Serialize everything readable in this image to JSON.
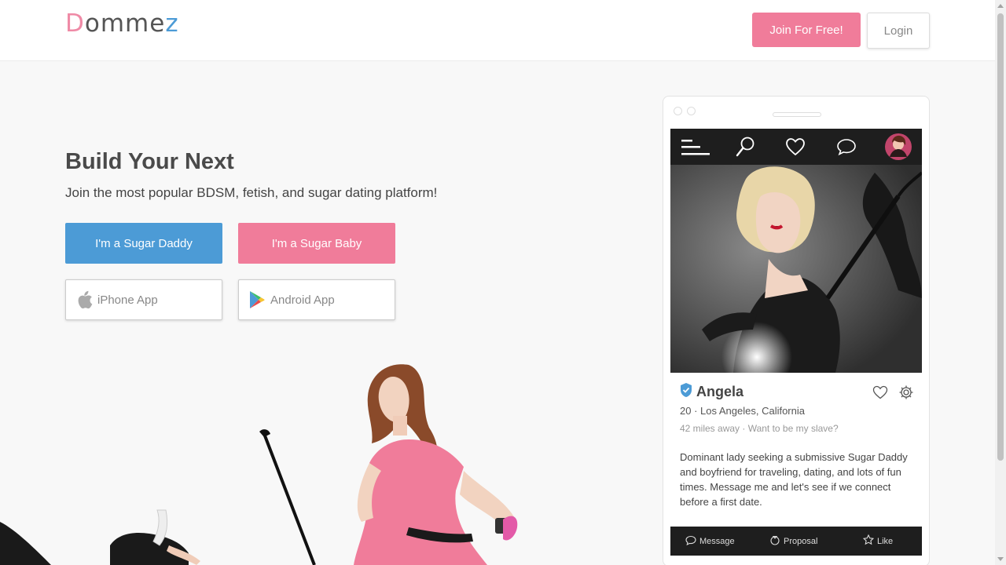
{
  "header": {
    "logo_first": "D",
    "logo_mid": "omme",
    "logo_last": "z",
    "join_label": "Join For Free!",
    "login_label": "Login"
  },
  "hero": {
    "title": "Build Your Next",
    "subtitle": "Join the most popular BDSM, fetish, and sugar dating platform!",
    "sugar_daddy_label": "I'm a Sugar Daddy",
    "sugar_baby_label": "I'm a Sugar Baby",
    "iphone_label": "iPhone App",
    "android_label": "Android App"
  },
  "profile": {
    "name": "Angela",
    "meta": "20 · Los Angeles, California",
    "meta2": "42 miles away · Want to be my slave?",
    "bio": "Dominant lady seeking a submissive Sugar Daddy and boyfriend for traveling, dating, and lots of fun times. Message me and let's see if we connect before a first date.",
    "actions": {
      "message": "Message",
      "proposal": "Proposal",
      "like": "Like"
    }
  },
  "colors": {
    "brand_pink": "#f07c9a",
    "brand_blue": "#4c9bd6",
    "app_dark": "#1e1e1e"
  },
  "icons": [
    "apple-icon",
    "play-store-icon",
    "menu-icon",
    "search-icon",
    "heart-icon",
    "chat-icon",
    "avatar",
    "verified-icon",
    "gear-icon",
    "message-icon",
    "proposal-icon",
    "star-icon"
  ]
}
